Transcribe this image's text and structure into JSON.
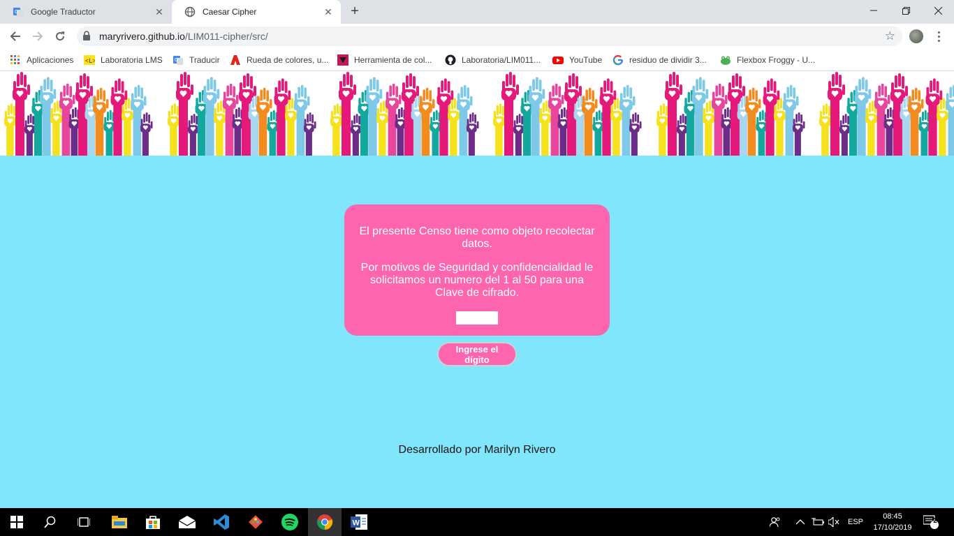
{
  "browser": {
    "tabs": [
      {
        "title": "Google Traductor",
        "favicon": "google-translate-icon"
      },
      {
        "title": "Caesar Cipher",
        "favicon": "globe-icon"
      }
    ],
    "address": {
      "host": "maryrivero.github.io",
      "path": "/LIM011-cipher/src/"
    }
  },
  "bookmarks": [
    {
      "label": "Aplicaciones",
      "icon": "apps-grid-icon"
    },
    {
      "label": "Laboratoria LMS",
      "icon": "laboratoria-icon"
    },
    {
      "label": "Traducir",
      "icon": "google-translate-icon"
    },
    {
      "label": "Rueda de colores, u...",
      "icon": "adobe-icon"
    },
    {
      "label": "Herramienta de col...",
      "icon": "color-tool-icon"
    },
    {
      "label": "Laboratoria/LIM011...",
      "icon": "github-icon"
    },
    {
      "label": "YouTube",
      "icon": "youtube-icon"
    },
    {
      "label": "residuo de dividir 3...",
      "icon": "google-icon"
    },
    {
      "label": "Flexbox Froggy - U...",
      "icon": "frog-icon"
    }
  ],
  "page": {
    "intro": "El presente Censo tiene como objeto recolectar datos.",
    "request": "Por motivos de Seguridad y confidencialidad le solicitamos un numero del 1 al 50 para una Clave de cifrado.",
    "key_value": "",
    "submit_label": "Ingrese el dígito",
    "footer": "Desarrollado por Marilyn Rivero"
  },
  "taskbar": {
    "language": "ESP",
    "time": "08:45",
    "date": "17/10/2019",
    "notifications": "2"
  },
  "colors": {
    "page_bg": "#80e6fc",
    "card_bg": "#fd65ae",
    "hands": [
      "#e5197a",
      "#f5e21c",
      "#13a89e",
      "#7ec8e8",
      "#6b2d87",
      "#f28c1e",
      "#e8459c",
      "#a7d6f0"
    ]
  }
}
